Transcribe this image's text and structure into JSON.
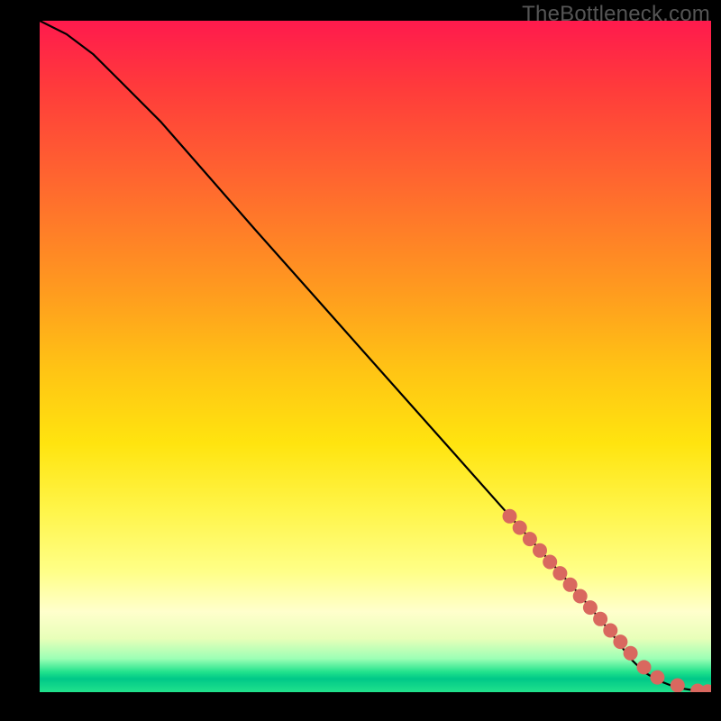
{
  "watermark": "TheBottleneck.com",
  "chart_data": {
    "type": "line",
    "title": "",
    "xlabel": "",
    "ylabel": "",
    "xlim": [
      0,
      100
    ],
    "ylim": [
      0,
      100
    ],
    "curve": {
      "x": [
        0,
        4,
        8,
        12,
        18,
        25,
        32,
        40,
        48,
        56,
        64,
        72,
        80,
        85,
        88,
        90,
        92,
        94,
        96,
        98,
        100
      ],
      "y": [
        100,
        98,
        95,
        91,
        85,
        77,
        69,
        60,
        51,
        42,
        33,
        24,
        15,
        9,
        5,
        3,
        1.8,
        1,
        0.5,
        0.2,
        0
      ]
    },
    "markers": {
      "x": [
        70,
        71.5,
        73,
        74.5,
        76,
        77.5,
        79,
        80.5,
        82,
        83.5,
        85,
        86.5,
        88,
        90,
        92,
        95,
        98,
        99.5
      ],
      "y": [
        26.2,
        24.5,
        22.8,
        21.1,
        19.4,
        17.7,
        16,
        14.3,
        12.6,
        10.9,
        9.2,
        7.5,
        5.8,
        3.7,
        2.2,
        1.0,
        0.2,
        0.1
      ]
    },
    "colors": {
      "curve": "#000000",
      "marker": "#d9685f"
    }
  }
}
